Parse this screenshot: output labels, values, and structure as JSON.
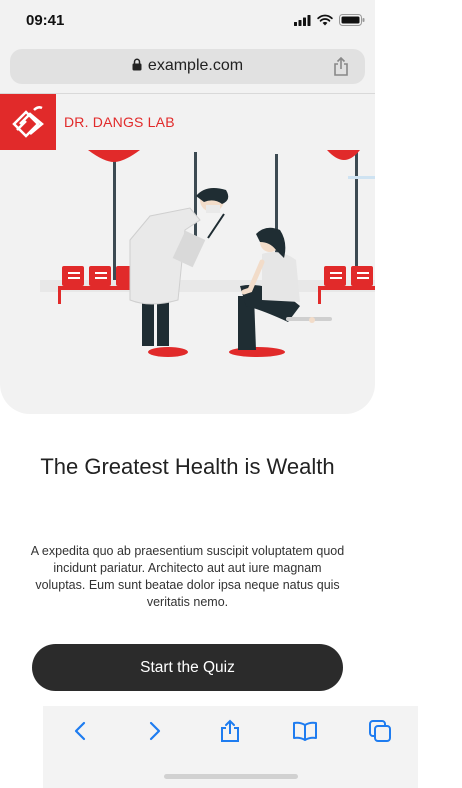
{
  "status_bar": {
    "time": "09:41"
  },
  "browser": {
    "url": "example.com"
  },
  "brand": {
    "name": "DR. DANGS LAB",
    "accent_color": "#e12a2a"
  },
  "hero": {
    "title": "The Greatest Health is Wealth",
    "description": "A expedita quo ab praesentium suscipit voluptatem quod incidunt pariatur. Architecto aut aut iure magnam voluptas. Eum sunt beatae dolor ipsa neque natus quis veritatis nemo."
  },
  "cta": {
    "label": "Start the Quiz"
  },
  "toolbar": {
    "items": [
      "back-icon",
      "forward-icon",
      "share-icon",
      "bookmarks-icon",
      "tabs-icon"
    ]
  }
}
